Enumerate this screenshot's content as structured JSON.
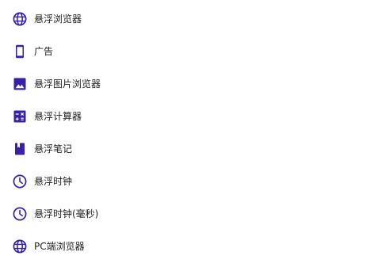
{
  "accent_color": "#3a1fa8",
  "menu": {
    "items": [
      {
        "label": "悬浮浏览器",
        "icon": "globe-icon"
      },
      {
        "label": "广告",
        "icon": "phone-icon"
      },
      {
        "label": "悬浮图片浏览器",
        "icon": "image-icon"
      },
      {
        "label": "悬浮计算器",
        "icon": "calculator-icon"
      },
      {
        "label": "悬浮笔记",
        "icon": "notebook-icon"
      },
      {
        "label": "悬浮时钟",
        "icon": "clock-icon"
      },
      {
        "label": "悬浮时钟(毫秒)",
        "icon": "clock-icon"
      },
      {
        "label": "PC端浏览器",
        "icon": "globe-icon"
      }
    ]
  }
}
